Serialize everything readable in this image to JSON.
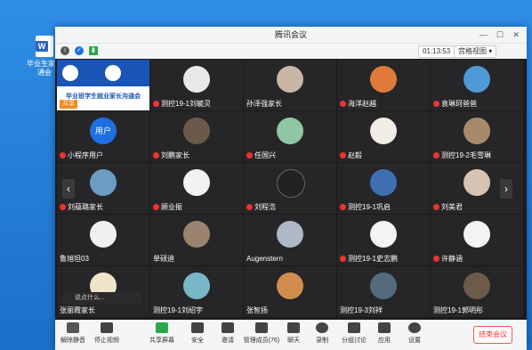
{
  "desktop": {
    "icon_label": "毕业生家长\n通会"
  },
  "window": {
    "title": "腾讯会议",
    "timer": "01:13:53",
    "view_label": "宫格视图"
  },
  "participants": [
    {
      "name": "",
      "kind": "share",
      "share_title": "毕业班学生就业家长沟通会",
      "share_label": "共享"
    },
    {
      "name": "测控19-1刘毓灵"
    },
    {
      "name": "孙泽强家长"
    },
    {
      "name": "海洋赵越"
    },
    {
      "name": "袁琳珂爸爸"
    },
    {
      "name": "小程序用户",
      "kind": "user",
      "badge": "用户"
    },
    {
      "name": "刘鹏家长"
    },
    {
      "name": "任国兴"
    },
    {
      "name": "赵毅"
    },
    {
      "name": "测控19-2毛雪琳"
    },
    {
      "name": "刘蕴璐家长"
    },
    {
      "name": "顾业振"
    },
    {
      "name": "刘程浩"
    },
    {
      "name": "测控19-1巩启"
    },
    {
      "name": "刘美君"
    },
    {
      "name": "鲁旭坦03"
    },
    {
      "name": "单硕迪"
    },
    {
      "name": "Augenstern"
    },
    {
      "name": "测控19-1史志鹏"
    },
    {
      "name": "许静涵"
    },
    {
      "name": "张丽霞家长"
    },
    {
      "name": "测控19-1刘绍宇"
    },
    {
      "name": "张智扬"
    },
    {
      "name": "测控19-3刘祥"
    },
    {
      "name": "测控19-1郭明彤"
    }
  ],
  "chat": {
    "placeholder": "说点什么..."
  },
  "toolbar": {
    "mute": "解除静音",
    "video": "停止视频",
    "share": "共享屏幕",
    "security": "安全",
    "invite": "邀请",
    "members": "管理成员(76)",
    "chat": "聊天",
    "record": "录制",
    "breakout": "分组讨论",
    "apps": "应用",
    "settings": "设置",
    "end": "结束会议"
  }
}
